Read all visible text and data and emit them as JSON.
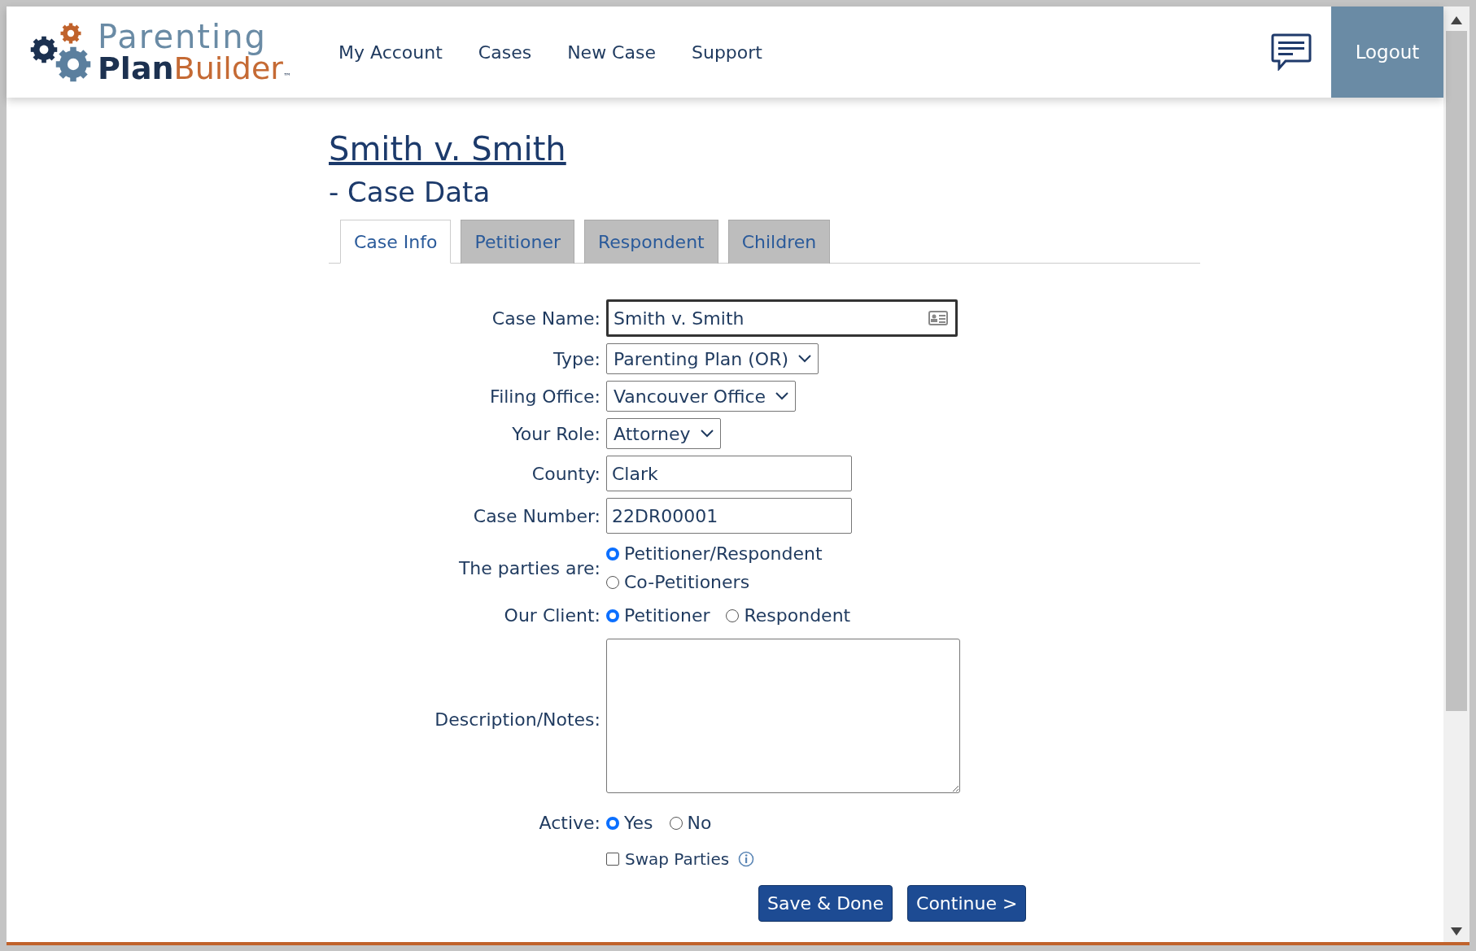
{
  "logo": {
    "top": "Parenting",
    "bold": "Plan",
    "rest": "Builder",
    "mark": "™"
  },
  "nav": [
    "My Account",
    "Cases",
    "New Case",
    "Support"
  ],
  "logout": "Logout",
  "case_title": "Smith v. Smith",
  "subtitle": "- Case Data",
  "tabs": [
    {
      "label": "Case Info",
      "selected": true
    },
    {
      "label": "Petitioner",
      "selected": false
    },
    {
      "label": "Respondent",
      "selected": false
    },
    {
      "label": "Children",
      "selected": false
    }
  ],
  "fields": [
    {
      "kind": "contact",
      "label": "Case Name:",
      "value": "Smith v. Smith"
    },
    {
      "kind": "select",
      "label": "Type:",
      "value": "Parenting Plan (OR)"
    },
    {
      "kind": "select",
      "label": "Filing Office:",
      "value": "Vancouver Office"
    },
    {
      "kind": "select",
      "label": "Your Role:",
      "value": "Attorney"
    },
    {
      "kind": "text",
      "label": "County:",
      "value": "Clark"
    },
    {
      "kind": "text",
      "label": "Case Number:",
      "value": "22DR00001"
    },
    {
      "kind": "radio_stacked",
      "label": "The parties are:",
      "options": [
        {
          "label": "Petitioner/Respondent",
          "selected": true
        },
        {
          "label": "Co-Petitioners",
          "selected": false
        }
      ]
    },
    {
      "kind": "radio",
      "label": "Our Client:",
      "options": [
        {
          "label": "Petitioner",
          "selected": true
        },
        {
          "label": "Respondent",
          "selected": false
        }
      ]
    },
    {
      "kind": "textarea",
      "label": "Description/Notes:"
    },
    {
      "kind": "radio",
      "label": "Active:",
      "options": [
        {
          "label": "Yes",
          "selected": true
        },
        {
          "label": "No",
          "selected": false
        }
      ]
    },
    {
      "kind": "checkbox",
      "label": "Swap Parties",
      "checked": false
    }
  ],
  "buttons": [
    "Save & Done",
    "Continue >"
  ]
}
